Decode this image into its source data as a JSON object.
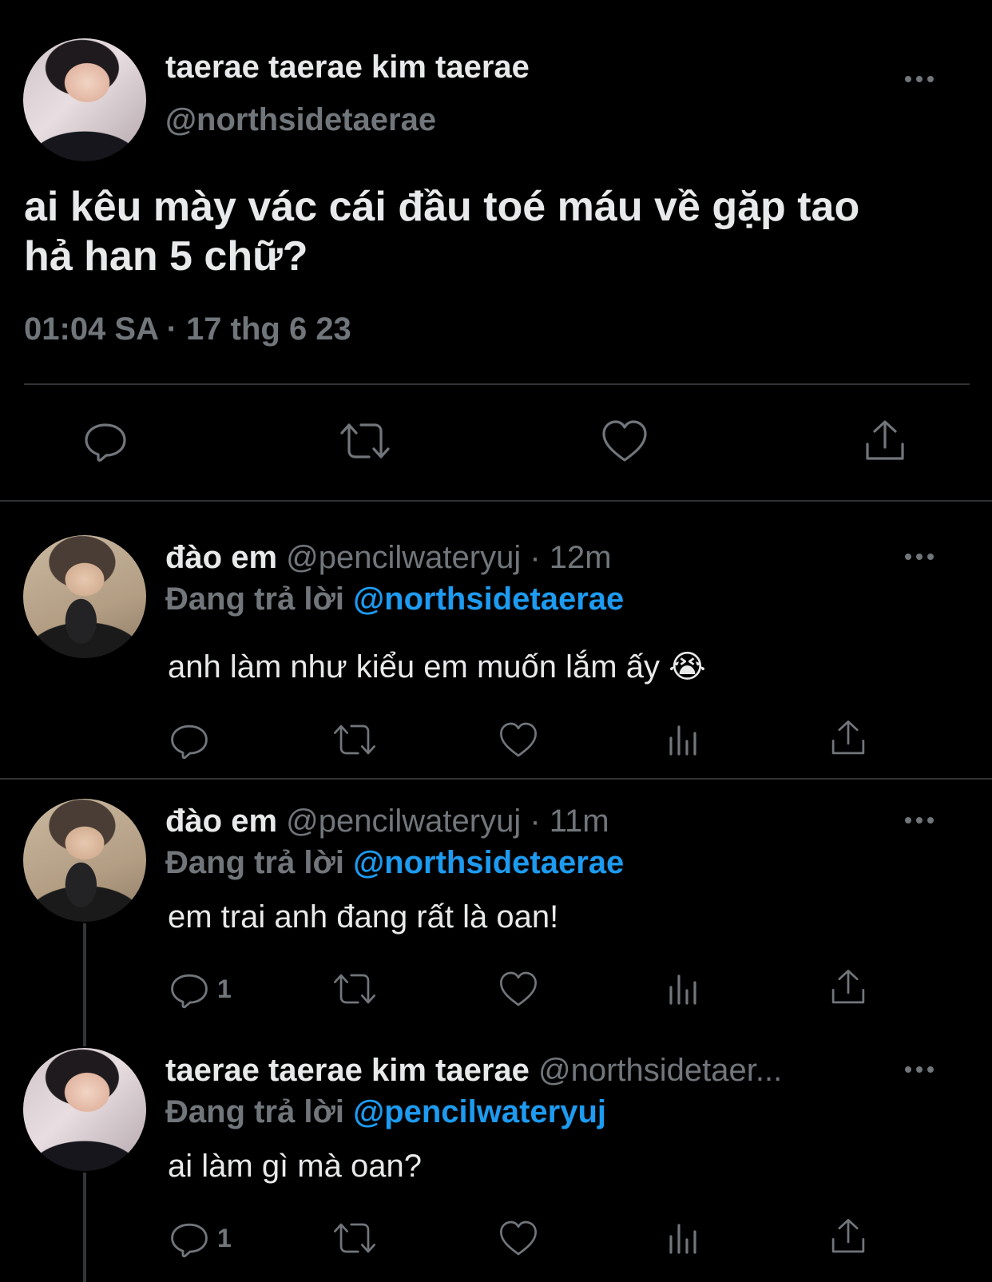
{
  "main_tweet": {
    "display_name": "taerae taerae kim taerae",
    "handle": "@northsidetaerae",
    "text_line1": "ai kêu mày vác cái đầu toé máu về gặp tao",
    "text_line2": "hả han 5 chữ?",
    "timestamp": "01:04 SA · 17 thg 6 23"
  },
  "reply_prefix": "Đang trả lời",
  "replies": [
    {
      "display_name": "đào em",
      "handle_time": "@pencilwateryuj · 12m",
      "replying_to": "@northsidetaerae",
      "text": "anh làm như kiểu em muốn lắm ấy 😭",
      "reply_count": ""
    },
    {
      "display_name": "đào em",
      "handle_time": "@pencilwateryuj · 11m",
      "replying_to": "@northsidetaerae",
      "text": "em trai anh đang rất là oan!",
      "reply_count": "1"
    },
    {
      "display_name": "taerae taerae kim taerae",
      "handle_time": "@northsidetaer...",
      "replying_to": "@pencilwateryuj",
      "text": "ai làm gì mà oan?",
      "reply_count": "1"
    }
  ],
  "icons": [
    "reply-icon",
    "retweet-icon",
    "like-icon",
    "views-icon",
    "share-icon",
    "more-icon"
  ],
  "colors": {
    "background": "#000000",
    "text": "#e7e9ea",
    "muted": "#71767b",
    "link": "#1d9bf0"
  }
}
